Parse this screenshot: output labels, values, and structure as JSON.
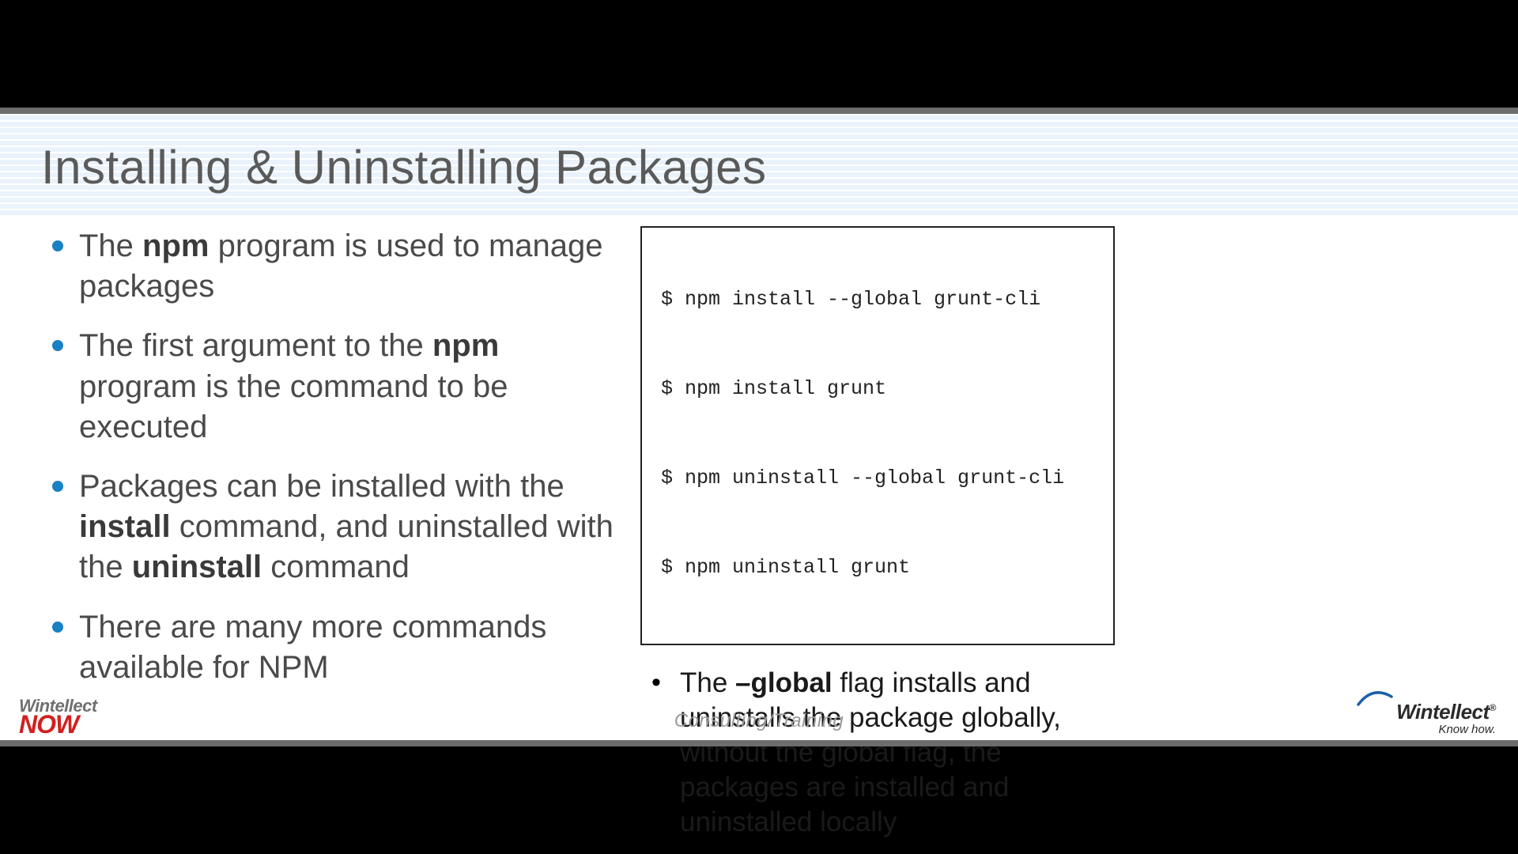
{
  "title": "Installing & Uninstalling Packages",
  "left_bullets": [
    {
      "pre": "The ",
      "b1": "npm",
      "mid": " program is used to manage packages",
      "b2": "",
      "post": ""
    },
    {
      "pre": "The first argument to the ",
      "b1": "npm",
      "mid": " program is the command to be executed",
      "b2": "",
      "post": ""
    },
    {
      "pre": "Packages can be installed with the ",
      "b1": "install",
      "mid": " command, and uninstalled with the ",
      "b2": "uninstall",
      "post": " command"
    },
    {
      "pre": "There are many more commands available for NPM",
      "b1": "",
      "mid": "",
      "b2": "",
      "post": ""
    }
  ],
  "code_lines": [
    "$ npm install --global grunt-cli",
    "$ npm install grunt",
    "$ npm uninstall --global grunt-cli",
    "$ npm uninstall grunt"
  ],
  "right_bullet": {
    "pre": "The ",
    "bold": "–global",
    "post": " flag installs and uninstalls the package globally, without the global flag, the packages are installed and uninstalled locally"
  },
  "footer_center": "Consulting/Training",
  "logo_left": {
    "line1": "Wintellect",
    "line2": "NOW"
  },
  "logo_right": {
    "brand": "Wintellect",
    "reg": "®",
    "tag": "Know how."
  }
}
